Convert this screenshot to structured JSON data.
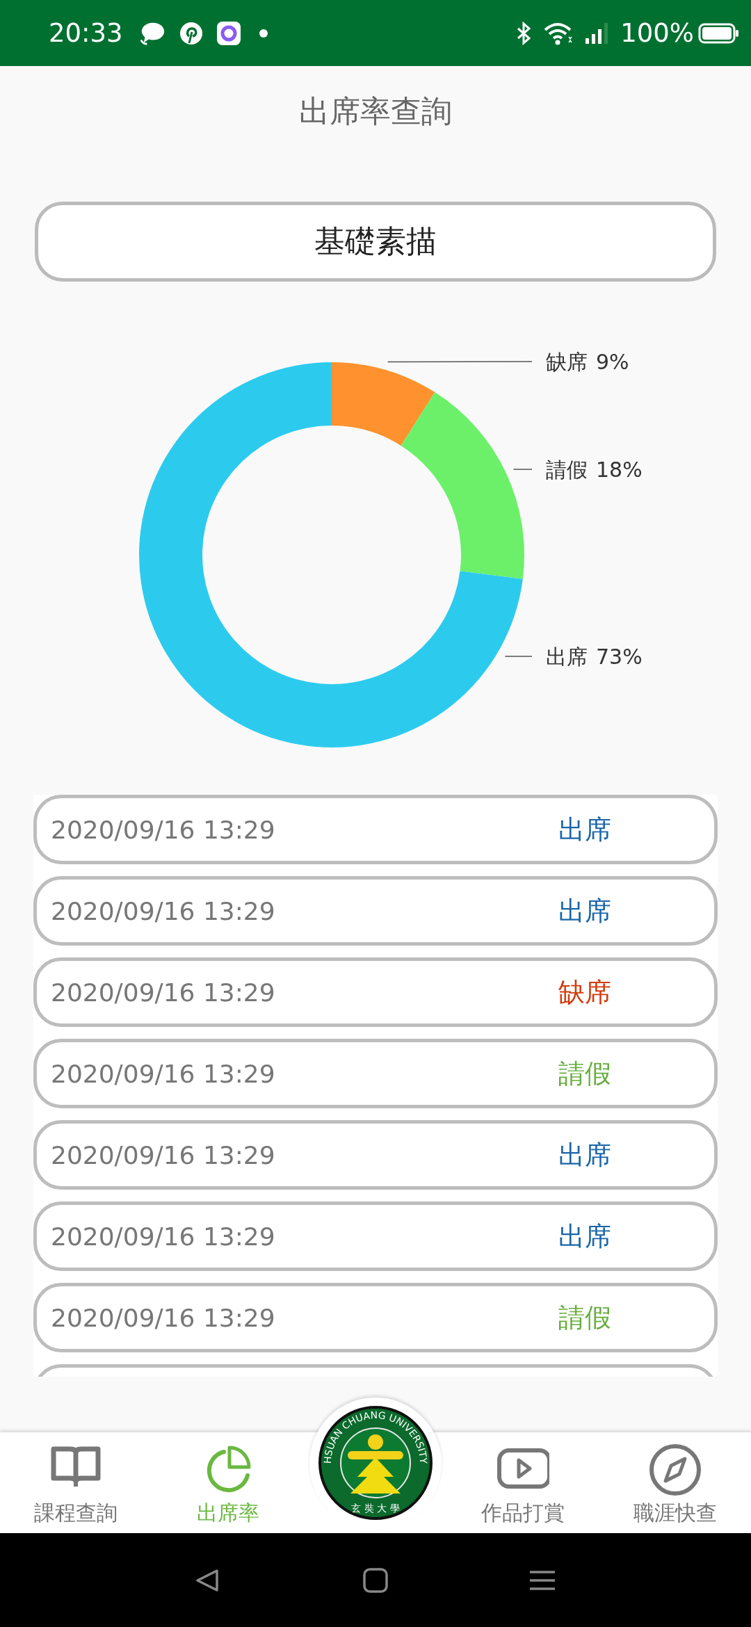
{
  "status_bar": {
    "time": "20:33",
    "battery": "100%"
  },
  "title": "出席率查詢",
  "course_select": {
    "value": "基礎素描"
  },
  "attendance_chart": {
    "chart_data": {
      "type": "donut",
      "categories": [
        "缺席",
        "請假",
        "出席"
      ],
      "values": [
        9,
        18,
        73
      ],
      "colors": [
        "#ff922e",
        "#6cf06a",
        "#2ccbee"
      ],
      "value_labels": [
        "9%",
        "18%",
        "73%"
      ]
    }
  },
  "records": [
    {
      "date": "2020/09/16 13:29",
      "status": "出席",
      "color": "#1a66a8"
    },
    {
      "date": "2020/09/16 13:29",
      "status": "出席",
      "color": "#1a66a8"
    },
    {
      "date": "2020/09/16 13:29",
      "status": "缺席",
      "color": "#d23c0e"
    },
    {
      "date": "2020/09/16 13:29",
      "status": "請假",
      "color": "#67ad3f"
    },
    {
      "date": "2020/09/16 13:29",
      "status": "出席",
      "color": "#1a66a8"
    },
    {
      "date": "2020/09/16 13:29",
      "status": "出席",
      "color": "#1a66a8"
    },
    {
      "date": "2020/09/16 13:29",
      "status": "請假",
      "color": "#67ad3f"
    }
  ],
  "bottom_nav": [
    {
      "kind": "book",
      "label": "課程查詢",
      "selected": false
    },
    {
      "kind": "pie",
      "label": "出席率",
      "selected": true
    },
    {
      "kind": "logo",
      "ring_text": "HSUAN CHUANG UNIVERSITY",
      "seal_text": "玄 奘 大 學",
      "selected": false
    },
    {
      "kind": "play",
      "label": "作品打賞",
      "selected": false
    },
    {
      "kind": "compass",
      "label": "職涯快查",
      "selected": false
    }
  ]
}
